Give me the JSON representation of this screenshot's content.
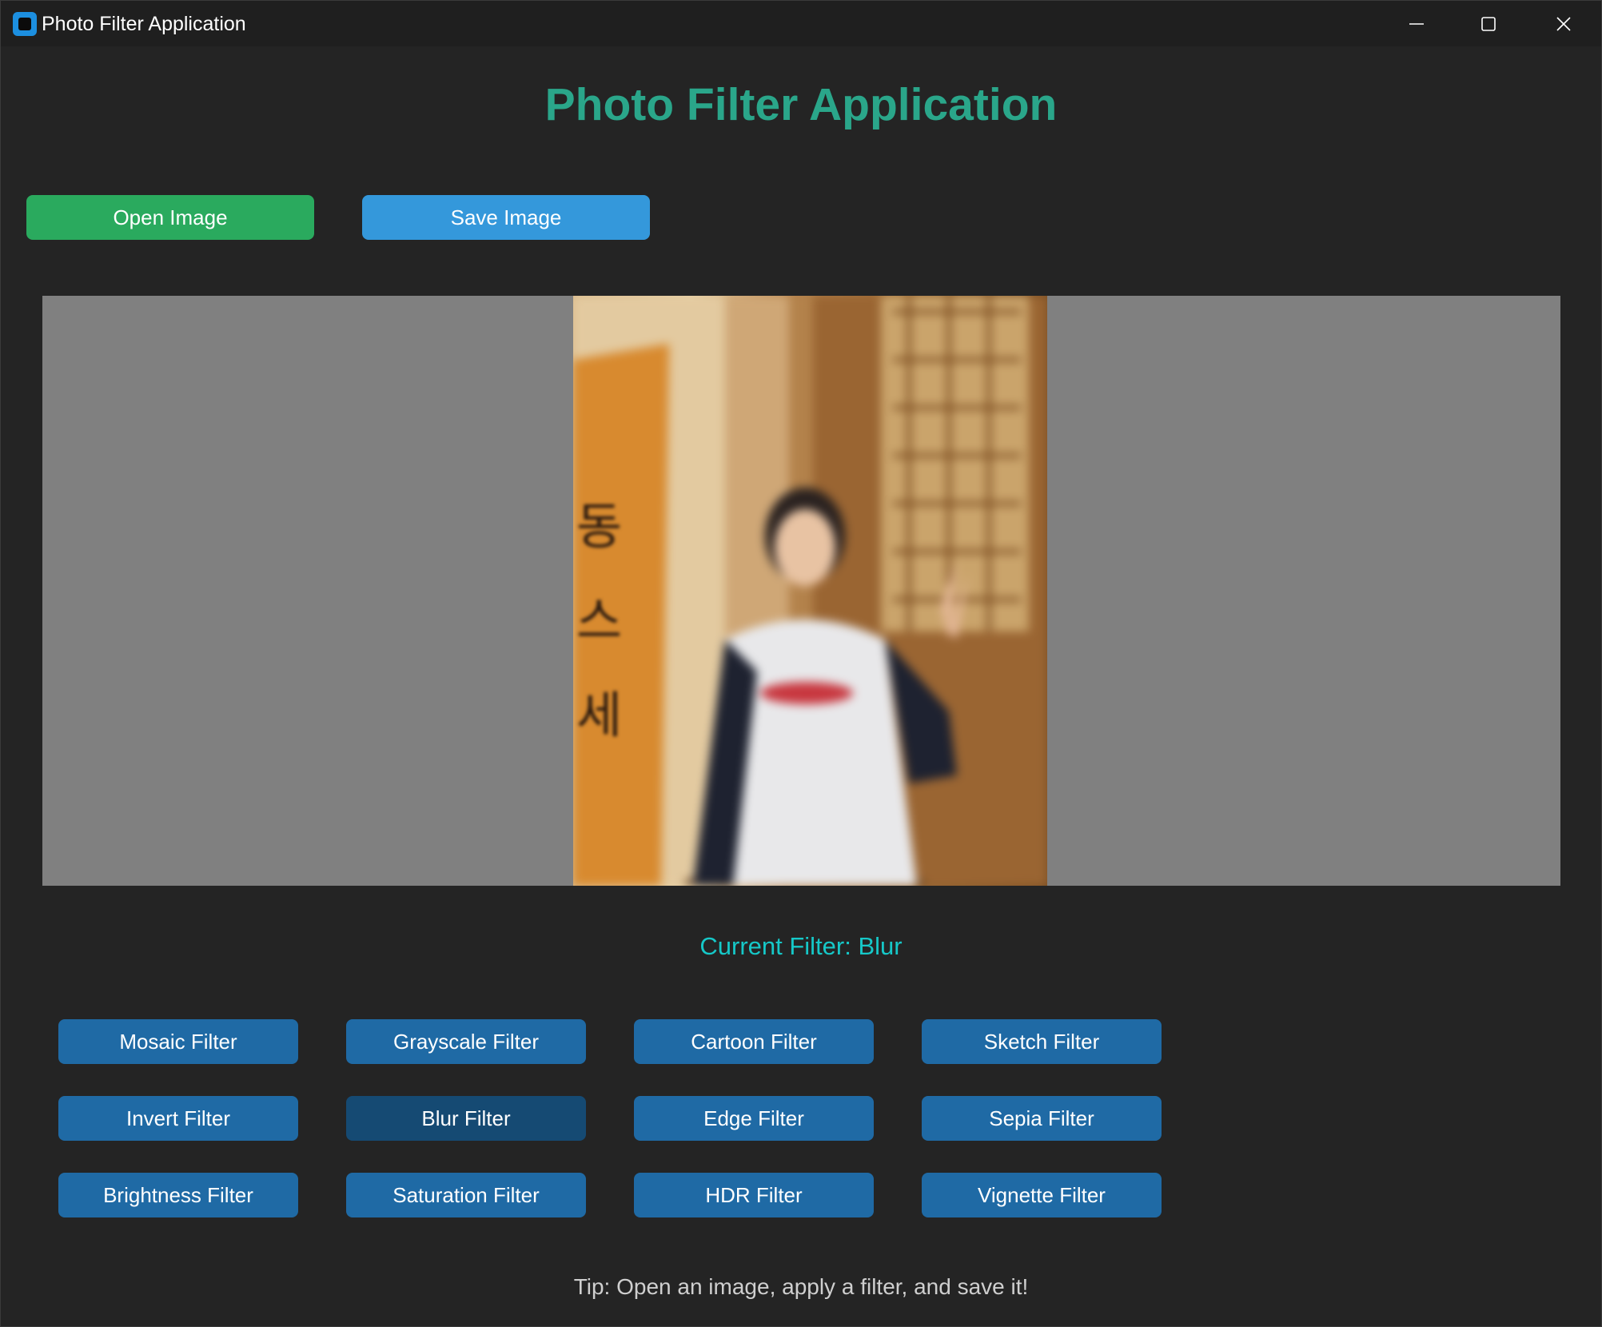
{
  "window": {
    "title": "Photo Filter Application",
    "controls": [
      "minimize-icon",
      "maximize-icon",
      "close-icon"
    ]
  },
  "header": {
    "title": "Photo Filter Application"
  },
  "toolbar": {
    "open_label": "Open Image",
    "save_label": "Save Image"
  },
  "preview": {
    "photo_text": [
      "동",
      "스",
      "세"
    ]
  },
  "status": {
    "current_filter": "Current Filter: Blur"
  },
  "filters": [
    {
      "label": "Mosaic Filter",
      "active": false
    },
    {
      "label": "Grayscale Filter",
      "active": false
    },
    {
      "label": "Cartoon Filter",
      "active": false
    },
    {
      "label": "Sketch Filter",
      "active": false
    },
    {
      "label": "Invert Filter",
      "active": false
    },
    {
      "label": "Blur Filter",
      "active": true
    },
    {
      "label": "Edge Filter",
      "active": false
    },
    {
      "label": "Sepia Filter",
      "active": false
    },
    {
      "label": "Brightness Filter",
      "active": false
    },
    {
      "label": "Saturation Filter",
      "active": false
    },
    {
      "label": "HDR Filter",
      "active": false
    },
    {
      "label": "Vignette Filter",
      "active": false
    }
  ],
  "footer": {
    "tip": "Tip: Open an image, apply a filter, and save it!"
  },
  "colors": {
    "heading": "#2aa68a",
    "open_button": "#2aaa5e",
    "save_button": "#3498db",
    "filter_button": "#1f6aa5",
    "filter_button_active": "#154a73",
    "current_filter_text": "#16c8c8"
  }
}
